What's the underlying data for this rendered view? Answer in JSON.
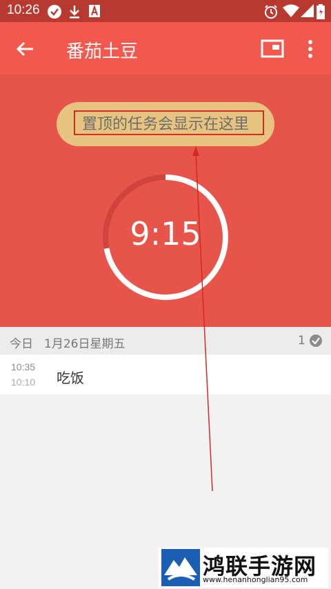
{
  "status_bar": {
    "time": "10:26",
    "left_icons": [
      "check-circle-icon",
      "download-icon",
      "notification-a-icon"
    ],
    "right_icons": [
      "alarm-icon",
      "wifi-icon",
      "signal-icon",
      "battery-icon"
    ]
  },
  "toolbar": {
    "title": "番茄土豆",
    "back_icon": "back-arrow-icon",
    "pip_icon": "picture-in-picture-icon",
    "more_icon": "more-vert-icon"
  },
  "hero": {
    "pinned_hint": "置顶的任务会显示在这里",
    "timer": "9:15",
    "timer_progress": 0.72
  },
  "day_group": {
    "label_today": "今日",
    "date": "1月26日星期五",
    "completed_count": "1"
  },
  "tasks": [
    {
      "end_time": "10:35",
      "start_time": "10:10",
      "name": "吃饭"
    }
  ],
  "watermark": {
    "brand": "鸿联手游网",
    "url": "www.henanhonglian95.com"
  },
  "colors": {
    "status_bar": "#b8392f",
    "toolbar": "#f2594e",
    "hero": "#e6544a",
    "pill": "#e6c37e",
    "highlight": "#d22a21",
    "list_bg": "#f2f2f2"
  }
}
